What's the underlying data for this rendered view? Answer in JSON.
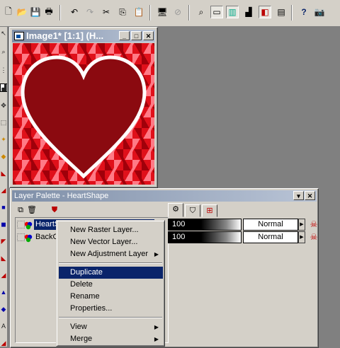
{
  "toolbar": {
    "buttons": [
      "new-icon",
      "open-icon",
      "save-icon",
      "print-icon",
      "undo-icon",
      "redo-icon",
      "cut-icon",
      "copy-icon",
      "paste-icon",
      "browse-icon",
      "disabled-icon",
      "zoom-icon",
      "toolbar-toggle-icon",
      "color-palette-icon",
      "histogram-icon",
      "layer-palette-icon",
      "overview-icon",
      "help-icon",
      "capture-icon"
    ]
  },
  "image_window": {
    "title": "Image1* [1:1] (H..."
  },
  "layer_palette": {
    "title": "Layer Palette - HeartShape",
    "layers": [
      {
        "name": "HeartSh",
        "opacity": "100",
        "blend": "Normal",
        "selected": true
      },
      {
        "name": "BackG",
        "opacity": "100",
        "blend": "Normal",
        "selected": false
      }
    ]
  },
  "context_menu": {
    "items": [
      {
        "label": "New Raster Layer...",
        "submenu": false
      },
      {
        "label": "New Vector Layer...",
        "submenu": false
      },
      {
        "label": "New Adjustment Layer",
        "submenu": true
      },
      {
        "label": "Duplicate",
        "submenu": false,
        "highlighted": true
      },
      {
        "label": "Delete",
        "submenu": false
      },
      {
        "label": "Rename",
        "submenu": false
      },
      {
        "label": "Properties...",
        "submenu": false
      },
      {
        "label": "View",
        "submenu": true
      },
      {
        "label": "Merge",
        "submenu": true
      }
    ]
  },
  "colors": {
    "selection": "#0a246a",
    "heart_fill": "#8b0a10",
    "tile_red": "#e0101a"
  }
}
